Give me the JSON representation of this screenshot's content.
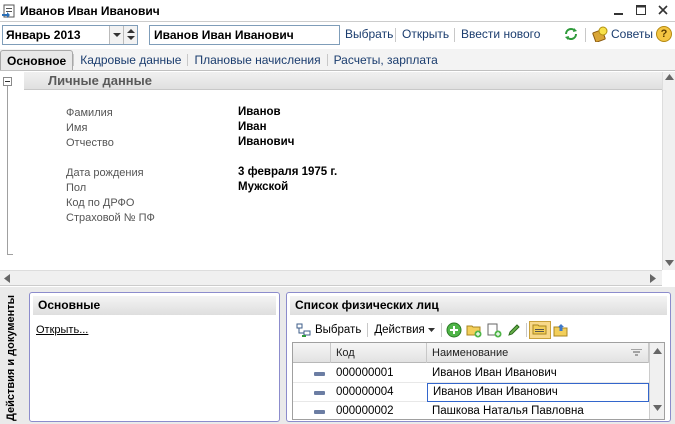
{
  "window": {
    "title": "Иванов Иван Иванович"
  },
  "toolbar": {
    "period_value": "Январь 2013",
    "person_value": "Иванов Иван Иванович",
    "select_label": "Выбрать",
    "open_label": "Открыть",
    "new_label": "Ввести нового",
    "tips_label": "Советы",
    "help_label": "?"
  },
  "tabs": [
    {
      "label": "Основное",
      "active": true
    },
    {
      "label": "Кадровые данные",
      "active": false
    },
    {
      "label": "Плановые начисления",
      "active": false
    },
    {
      "label": "Расчеты, зарплата",
      "active": false
    }
  ],
  "personal": {
    "heading": "Личные данные",
    "fields": [
      {
        "label": "Фамилия",
        "value": "Иванов"
      },
      {
        "label": "Имя",
        "value": "Иван"
      },
      {
        "label": "Отчество",
        "value": "Иванович"
      },
      {
        "label": "Дата рождения",
        "value": "3 февраля 1975 г."
      },
      {
        "label": "Пол",
        "value": "Мужской"
      },
      {
        "label": "Код по ДРФО",
        "value": ""
      },
      {
        "label": "Страховой № ПФ",
        "value": ""
      }
    ]
  },
  "bottom": {
    "side_label": "Действия и документы",
    "main_box": {
      "heading": "Основные",
      "open_link": "Открыть..."
    },
    "list_box": {
      "heading": "Список физических лиц",
      "select_label": "Выбрать",
      "actions_label": "Действия",
      "columns": [
        "Код",
        "Наименование"
      ],
      "rows": [
        {
          "code": "000000001",
          "name": "Иванов Иван Иванович",
          "selected": false
        },
        {
          "code": "000000004",
          "name": "Иванов Иван Иванович",
          "selected": true
        },
        {
          "code": "000000002",
          "name": "Пашкова Наталья Павловна",
          "selected": false
        }
      ]
    }
  },
  "colors": {
    "accent": "#3366cc",
    "link": "#1a3c6e",
    "frame": "#8c8ccc"
  }
}
